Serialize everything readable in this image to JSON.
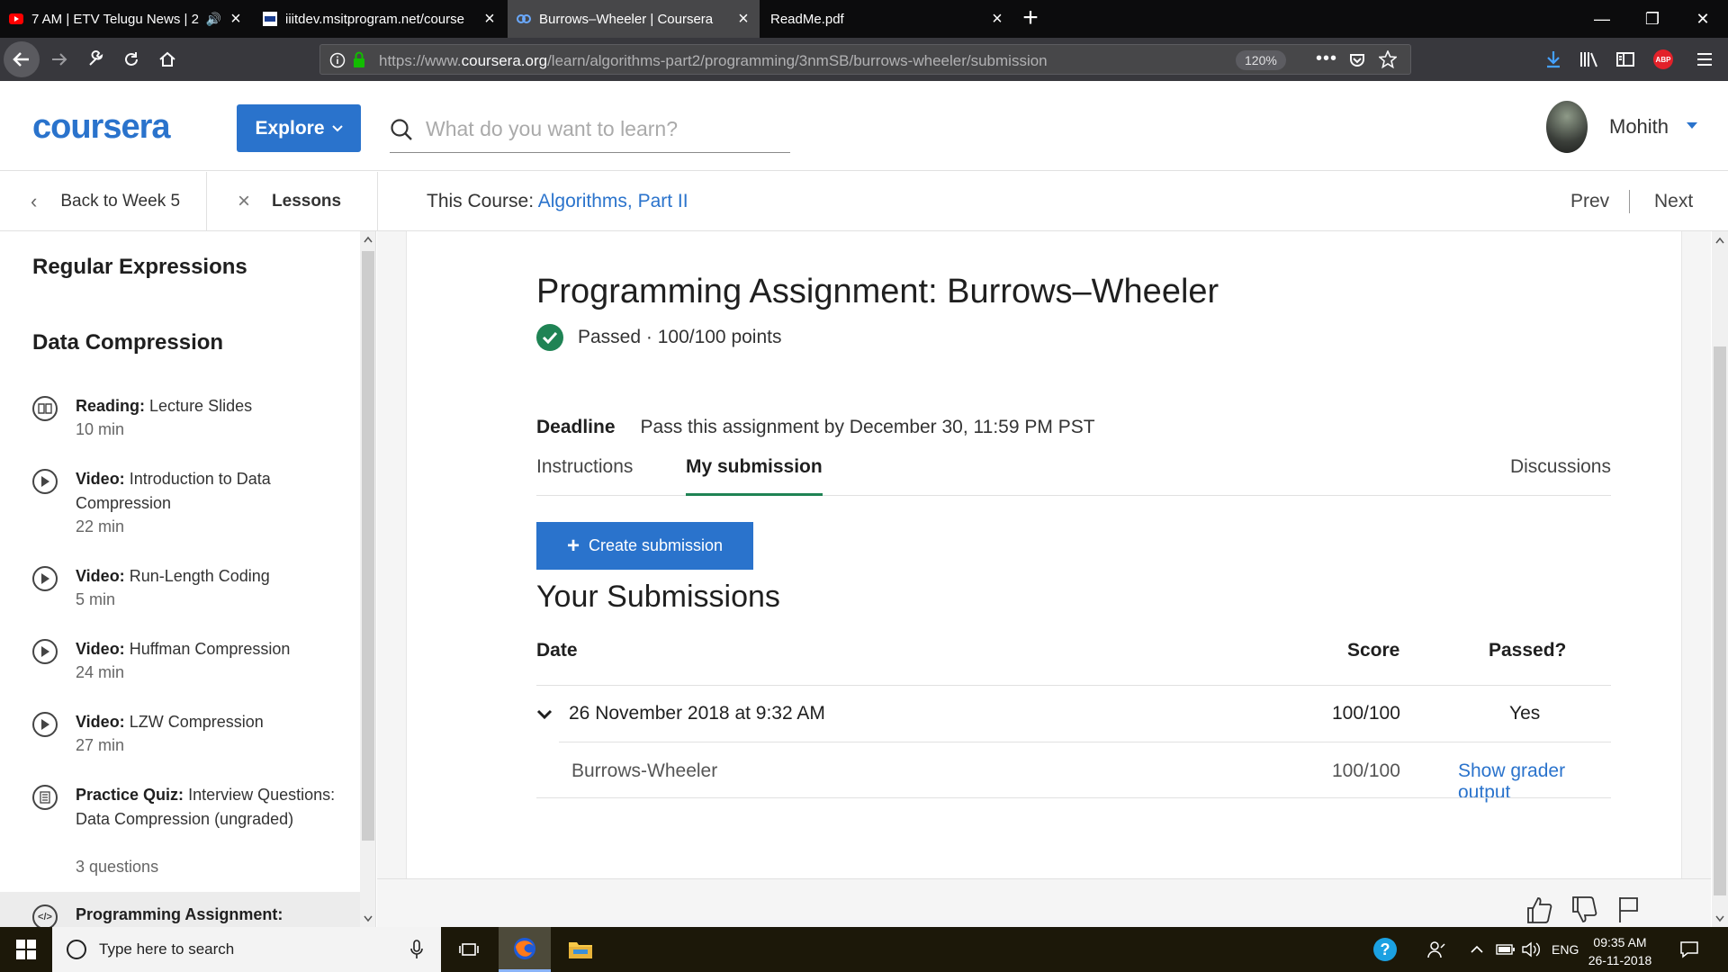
{
  "browser": {
    "tabs": [
      {
        "title": "7 AM | ETV Telugu News | 2",
        "favicon": "youtube-icon",
        "audio": true
      },
      {
        "title": "iiitdev.msitprogram.net/course",
        "favicon": "msit-icon"
      },
      {
        "title": "Burrows–Wheeler | Coursera",
        "favicon": "coursera-icon",
        "active": true
      },
      {
        "title": "ReadMe.pdf",
        "favicon": ""
      }
    ],
    "url_prefix": "https://www.",
    "url_domain": "coursera.org",
    "url_path": "/learn/algorithms-part2/programming/3nmSB/burrows-wheeler/submission",
    "zoom": "120%",
    "addon_label": "ABP"
  },
  "header": {
    "logo": "coursera",
    "explore_label": "Explore",
    "search_placeholder": "What do you want to learn?",
    "user_name": "Mohith"
  },
  "subnav": {
    "back_label": "Back to Week 5",
    "lessons_label": "Lessons",
    "course_prefix": "This Course: ",
    "course_name": "Algorithms, Part II",
    "prev_label": "Prev",
    "next_label": "Next"
  },
  "sidebar": {
    "section1": "Regular Expressions",
    "section2": "Data Compression",
    "items": [
      {
        "type": "Reading:",
        "title": "Lecture Slides",
        "duration": "10 min",
        "icon": "book-icon"
      },
      {
        "type": "Video:",
        "title": "Introduction to Data Compression",
        "duration": "22 min",
        "icon": "play-icon"
      },
      {
        "type": "Video:",
        "title": "Run-Length Coding",
        "duration": "5 min",
        "icon": "play-icon"
      },
      {
        "type": "Video:",
        "title": "Huffman Compression",
        "duration": "24 min",
        "icon": "play-icon"
      },
      {
        "type": "Video:",
        "title": "LZW Compression",
        "duration": "27 min",
        "icon": "play-icon"
      },
      {
        "type": "Practice Quiz:",
        "title": "Interview Questions: Data Compression (ungraded)",
        "duration": "3 questions",
        "icon": "quiz-icon"
      },
      {
        "type": "Programming Assignment:",
        "title": "",
        "duration": "",
        "icon": "code-icon"
      }
    ]
  },
  "main": {
    "title": "Programming Assignment: Burrows–Wheeler",
    "status": "Passed · 100/100 points",
    "deadline_label": "Deadline",
    "deadline_text": "Pass this assignment by December 30, 11:59 PM PST",
    "tabs": [
      "Instructions",
      "My submission",
      "Discussions"
    ],
    "create_label": "Create submission",
    "submissions_title": "Your Submissions",
    "columns": [
      "Date",
      "Score",
      "Passed?"
    ],
    "submission": {
      "date": "26 November 2018 at 9:32 AM",
      "score": "100/100",
      "passed": "Yes"
    },
    "part": {
      "name": "Burrows-Wheeler",
      "score": "100/100",
      "link": "Show grader output"
    }
  },
  "taskbar": {
    "search_placeholder": "Type here to search",
    "lang": "ENG",
    "time": "09:35 AM",
    "date": "26-11-2018"
  },
  "colors": {
    "accent": "#2a73cc",
    "success": "#1f8354"
  }
}
